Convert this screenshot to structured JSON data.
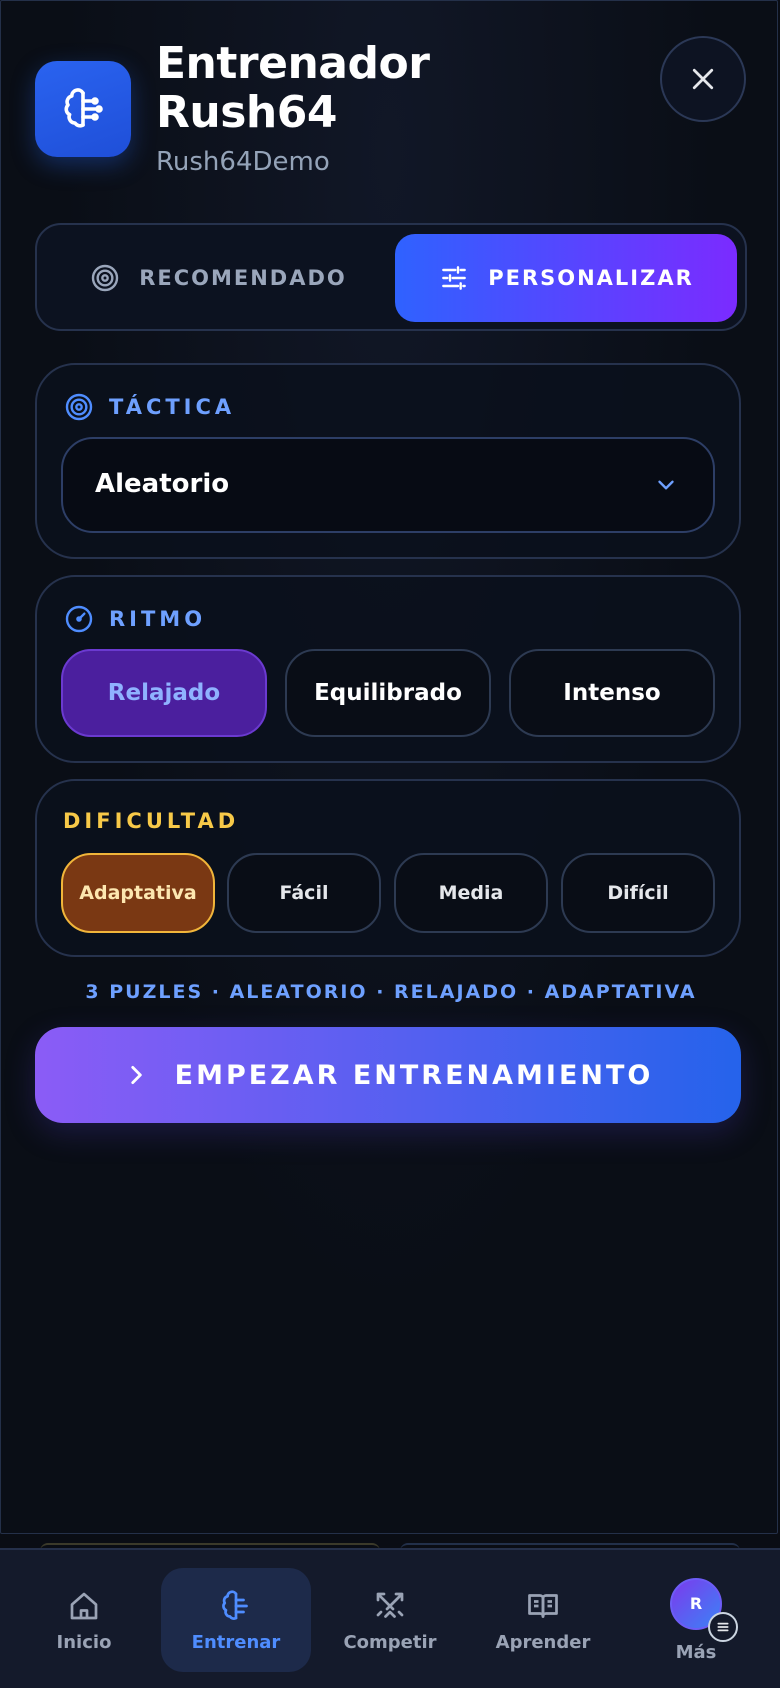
{
  "header": {
    "title_line1": "Entrenador",
    "title_line2": "Rush64",
    "subtitle": "Rush64Demo",
    "app_icon": "brain-icon",
    "close_icon": "close-icon"
  },
  "mode_switch": {
    "recommended": {
      "label": "RECOMENDADO",
      "icon": "target-icon",
      "selected": false
    },
    "customize": {
      "label": "PERSONALIZAR",
      "icon": "sliders-icon",
      "selected": true
    }
  },
  "tactic": {
    "label": "TÁCTICA",
    "icon": "target-icon",
    "selected_value": "Aleatorio"
  },
  "rhythm": {
    "label": "RITMO",
    "icon": "gauge-icon",
    "options": [
      "Relajado",
      "Equilibrado",
      "Intenso"
    ],
    "selected": "Relajado"
  },
  "difficulty": {
    "label": "DIFICULTAD",
    "options": [
      "Adaptativa",
      "Fácil",
      "Media",
      "Difícil"
    ],
    "selected": "Adaptativa"
  },
  "summary": "3 PUZLES · ALEATORIO · RELAJADO · ADAPTATIVA",
  "start_button": {
    "label": "EMPEZAR ENTRENAMIENTO",
    "icon": "chevron-right-icon"
  },
  "bottom_nav": {
    "items": [
      {
        "label": "Inicio",
        "icon": "home-icon",
        "active": false
      },
      {
        "label": "Entrenar",
        "icon": "brain-icon",
        "active": true
      },
      {
        "label": "Competir",
        "icon": "swords-icon",
        "active": false
      },
      {
        "label": "Aprender",
        "icon": "book-icon",
        "active": false
      },
      {
        "label": "Más",
        "icon": "avatar",
        "active": false
      }
    ],
    "avatar_initial": "R"
  },
  "colors": {
    "accent_blue": "#2f62ff",
    "accent_purple": "#7b2bff",
    "label_blue": "#6ea0ff",
    "label_yellow": "#f7c948",
    "selected_amber": "#7a3813"
  }
}
